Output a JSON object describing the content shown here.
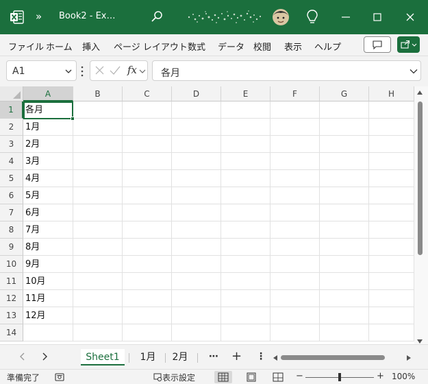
{
  "titlebar": {
    "more_label": "»",
    "title": "Book2  -  Ex…",
    "brand_color": "#1b6f3d"
  },
  "menu": {
    "items": [
      "ファイル",
      "ホーム",
      "挿入",
      "ページ レイアウト",
      "数式",
      "データ",
      "校閲",
      "表示",
      "ヘルプ"
    ]
  },
  "formula_bar": {
    "name_box": "A1",
    "fx_label": "fx",
    "content": "各月"
  },
  "grid": {
    "columns": [
      "A",
      "B",
      "C",
      "D",
      "E",
      "F",
      "G",
      "H"
    ],
    "rows": [
      "1",
      "2",
      "3",
      "4",
      "5",
      "6",
      "7",
      "8",
      "9",
      "10",
      "11",
      "12",
      "13",
      "14"
    ],
    "column_a": [
      "各月",
      "1月",
      "2月",
      "3月",
      "4月",
      "5月",
      "6月",
      "7月",
      "8月",
      "9月",
      "10月",
      "11月",
      "12月",
      ""
    ]
  },
  "sheets": {
    "tabs": [
      "Sheet1",
      "1月",
      "2月"
    ],
    "active": "Sheet1",
    "more_label": "⋯",
    "add_label": "+",
    "options_label": "⋮"
  },
  "status": {
    "ready": "準備完了",
    "display_settings": "表示設定",
    "zoom_minus": "−",
    "zoom_plus": "+",
    "zoom_level": "100%"
  }
}
